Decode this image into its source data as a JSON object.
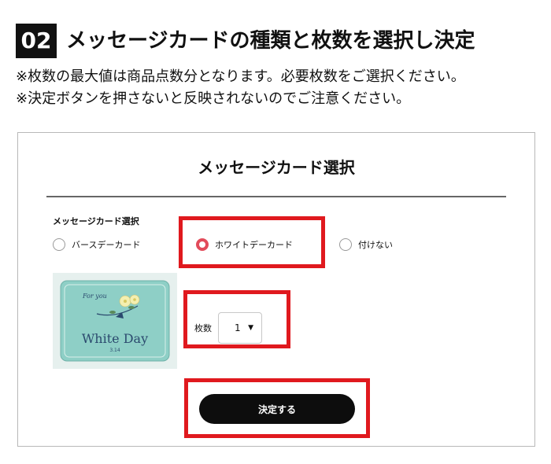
{
  "step": {
    "number": "02",
    "title": "メッセージカードの種類と枚数を選択し決定",
    "notes": [
      "※枚数の最大値は商品点数分となります。必要枚数をご選択ください。",
      "※決定ボタンを押さないと反映されないのでご注意ください。"
    ]
  },
  "panel": {
    "title": "メッセージカード選択",
    "group_label": "メッセージカード選択",
    "options": [
      {
        "label": "バースデーカード",
        "selected": false
      },
      {
        "label": "ホワイトデーカード",
        "selected": true
      },
      {
        "label": "付けない",
        "selected": false
      }
    ],
    "card_image": {
      "script_text": "For you",
      "title": "White Day",
      "date": "3.14"
    },
    "quantity": {
      "label": "枚数",
      "value": "1"
    },
    "submit_label": "決定する"
  },
  "colors": {
    "highlight": "#e0191e",
    "radio_selected": "#e24b5a",
    "card_bg": "#8ecfc6",
    "card_text": "#2b4a6e"
  }
}
